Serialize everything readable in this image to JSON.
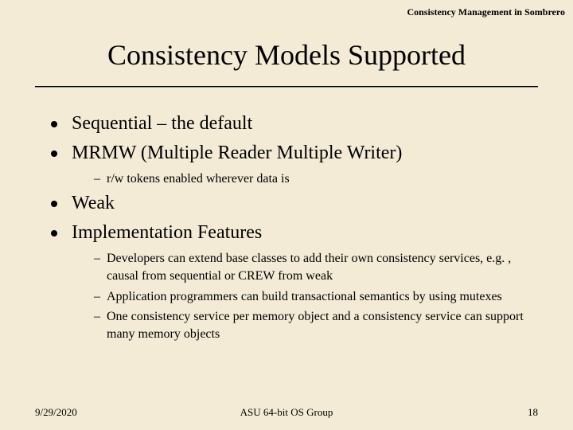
{
  "header": "Consistency Management in Sombrero",
  "title": "Consistency Models Supported",
  "bullet1": "Sequential – the default",
  "bullet2": "MRMW (Multiple Reader Multiple Writer)",
  "bullet2_sub1": "r/w tokens enabled wherever data is",
  "bullet3": "Weak",
  "bullet4": "Implementation Features",
  "bullet4_sub1": "Developers can extend base classes to add their own consistency services, e.g. , causal from sequential or CREW from weak",
  "bullet4_sub2": "Application programmers can build transactional semantics by using mutexes",
  "bullet4_sub3": "One consistency service per memory object and a consistency service can support many memory objects",
  "footer": {
    "date": "9/29/2020",
    "center": "ASU 64-bit OS Group",
    "page": "18"
  }
}
